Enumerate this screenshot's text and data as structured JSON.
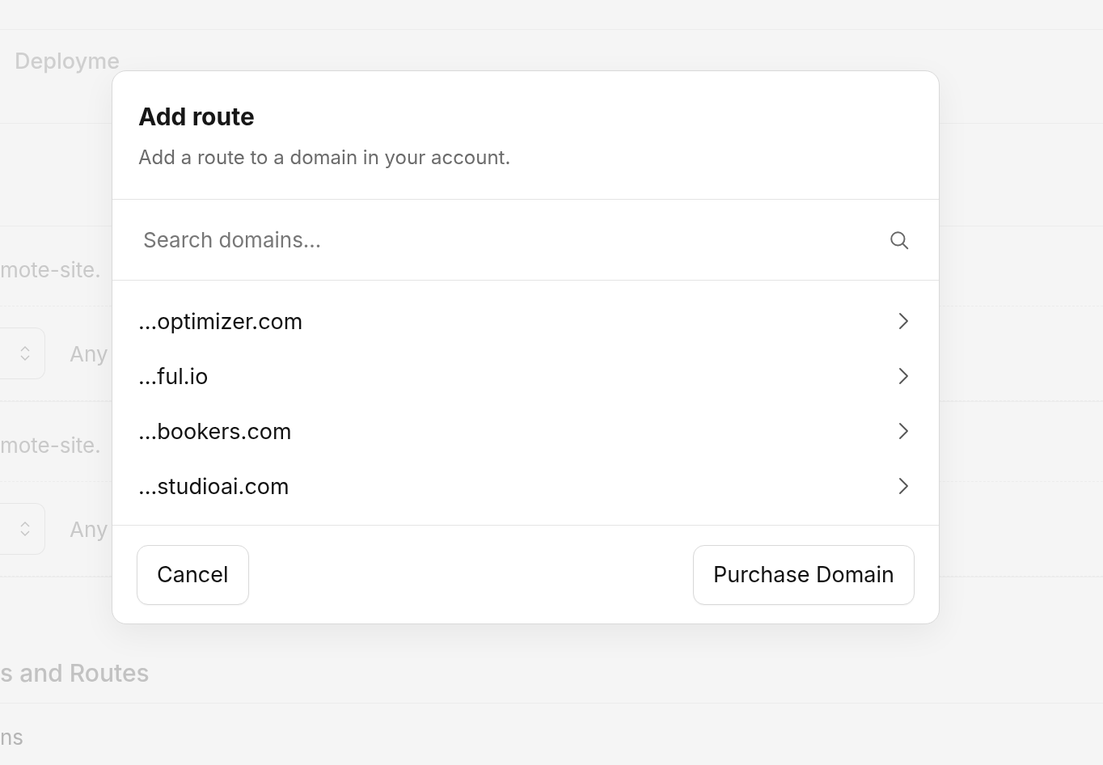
{
  "page": {
    "tabs": [
      {
        "label": "Deployme",
        "selected": false
      }
    ],
    "routes": [
      {
        "domain": "mote-site.",
        "access": "Any"
      },
      {
        "domain": "mote-site.",
        "access": "Any"
      }
    ],
    "section_title": "s and Routes",
    "section_row": "ns"
  },
  "dialog": {
    "title": "Add route",
    "description": "Add a route to a domain in your account.",
    "search": {
      "placeholder": "Search domains..."
    },
    "domains": [
      {
        "name": "...optimizer.com"
      },
      {
        "name": "...ful.io"
      },
      {
        "name": "...bookers.com"
      },
      {
        "name": "...studioai.com"
      }
    ],
    "buttons": [
      {
        "label": "Cancel"
      },
      {
        "label": "Purchase Domain"
      }
    ]
  }
}
